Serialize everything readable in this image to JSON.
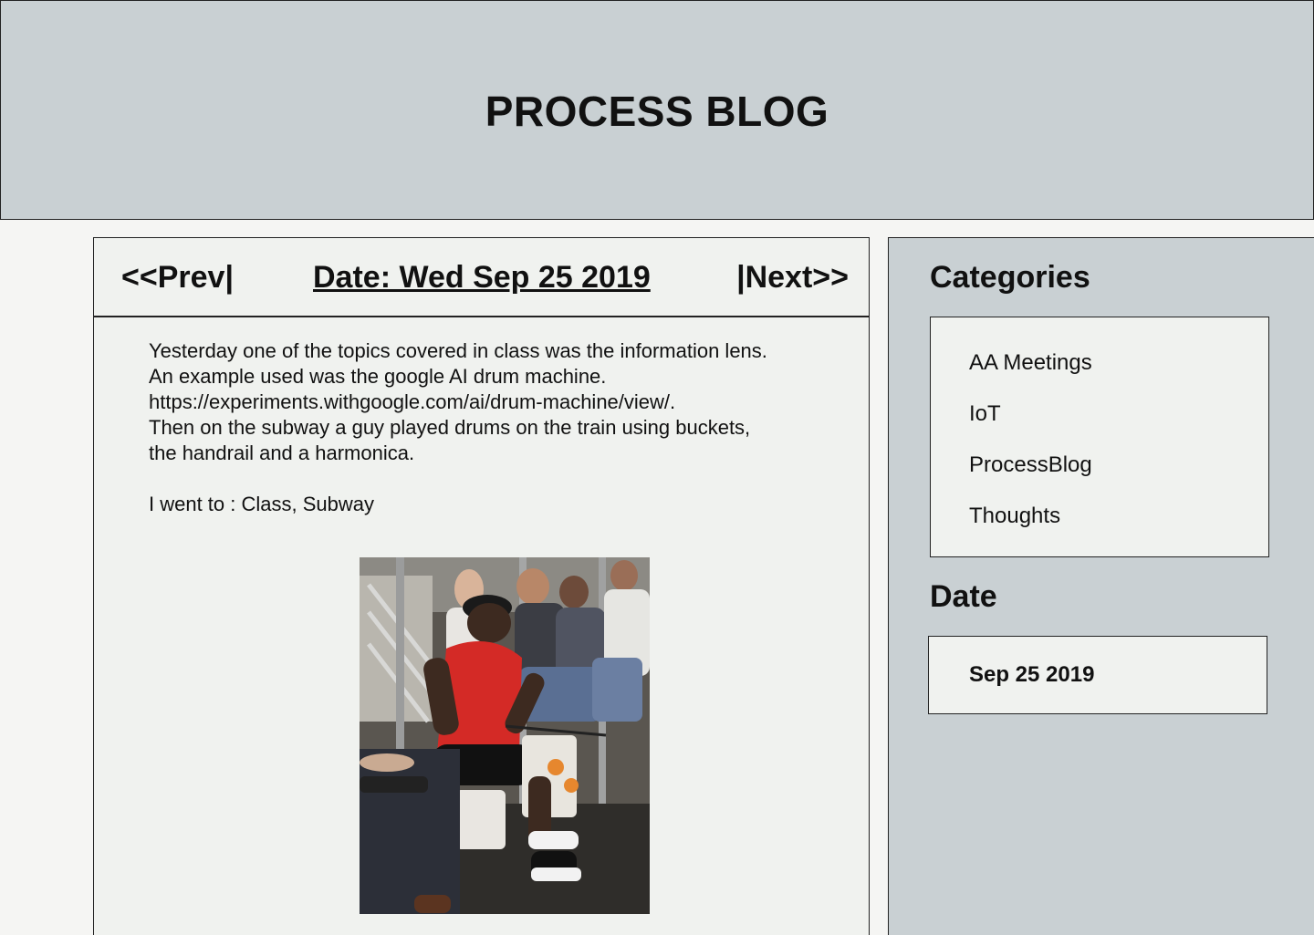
{
  "header": {
    "title": "PROCESS BLOG"
  },
  "post": {
    "nav": {
      "prev": "<<Prev|",
      "date": "Date: Wed Sep 25 2019",
      "next": "|Next>>"
    },
    "lines": [
      "Yesterday one of the topics covered in class was the information lens.",
      "An example used was the google AI drum machine.",
      "https://experiments.withgoogle.com/ai/drum-machine/view/.",
      "Then on the subway a guy played drums on the train using buckets,",
      "the handrail and a harmonica."
    ],
    "went_to": "I went to : Class, Subway"
  },
  "sidebar": {
    "categories_heading": "Categories",
    "categories": [
      "AA Meetings",
      "IoT",
      "ProcessBlog",
      "Thoughts"
    ],
    "date_heading": "Date",
    "dates": [
      "Sep 25 2019"
    ]
  }
}
